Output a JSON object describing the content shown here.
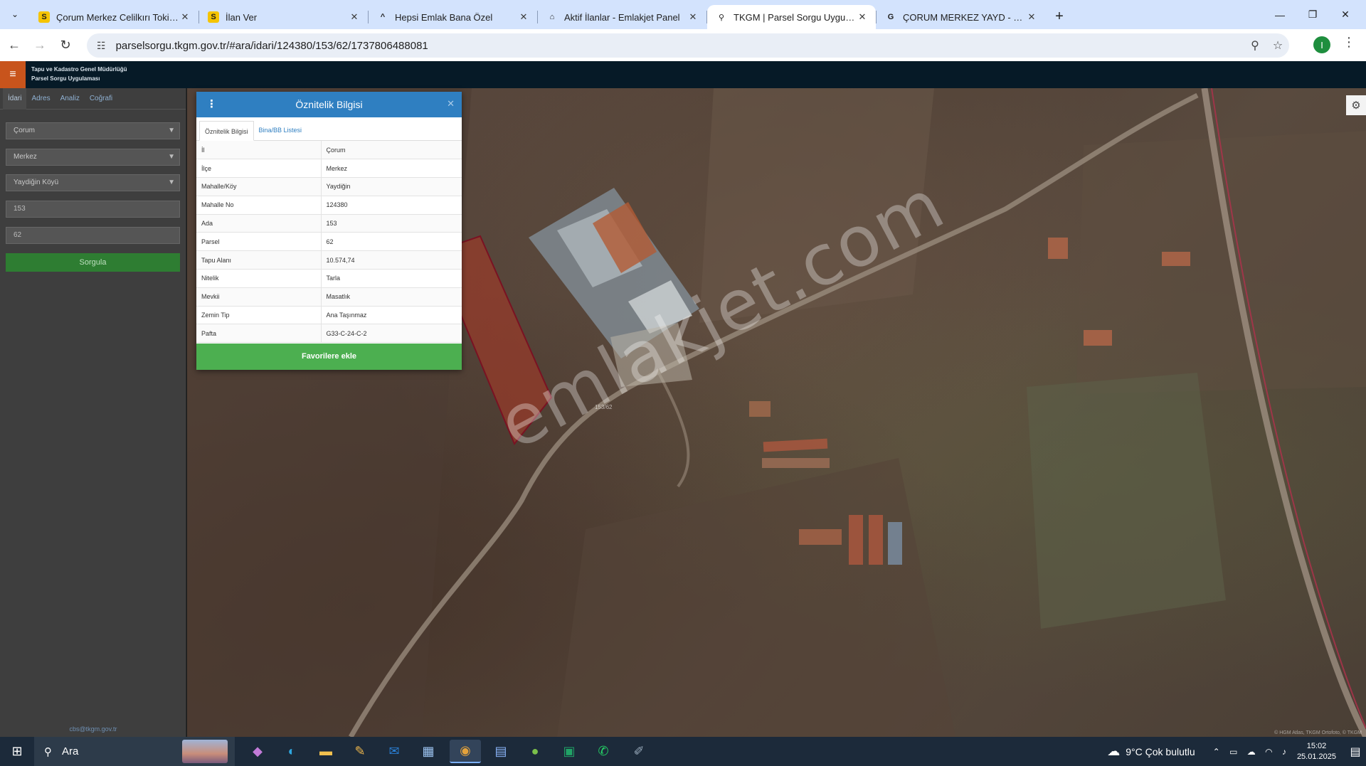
{
  "browser": {
    "tabs": [
      {
        "title": "Çorum Merkez Celilkırı Toki Anl",
        "favicon": "S",
        "favicon_bg": "#f5c400",
        "active": false
      },
      {
        "title": "İlan Ver",
        "favicon": "S",
        "favicon_bg": "#f5c400",
        "active": false
      },
      {
        "title": "Hepsi Emlak Bana Özel",
        "favicon": "^",
        "favicon_bg": "transparent",
        "active": false
      },
      {
        "title": "Aktif İlanlar - Emlakjet Panel",
        "favicon": "⌂",
        "favicon_bg": "transparent",
        "active": false
      },
      {
        "title": "TKGM | Parsel Sorgu Uygulaması",
        "favicon": "⚲",
        "favicon_bg": "transparent",
        "active": true
      },
      {
        "title": "ÇORUM MERKEZ YAYD - Google",
        "favicon": "G",
        "favicon_bg": "transparent",
        "active": false
      }
    ],
    "url": "parselsorgu.tkgm.gov.tr/#ara/idari/124380/153/62/1737806488081",
    "profile_initial": "I"
  },
  "app": {
    "title_line1": "Tapu ve Kadastro Genel Müdürlüğü",
    "title_line2": "Parsel Sorgu Uygulaması",
    "accent": "#c8541c"
  },
  "sidebar": {
    "tabs": [
      "İdari",
      "Adres",
      "Analiz",
      "Coğrafi"
    ],
    "province": "Çorum",
    "district": "Merkez",
    "neighborhood": "Yaydiğin Köyü",
    "ada": "153",
    "parsel": "62",
    "query_button": "Sorgula",
    "footer_email": "cbs@tkgm.gov.tr"
  },
  "panel": {
    "title": "Öznitelik Bilgisi",
    "tabs": [
      "Öznitelik Bilgisi",
      "Bina/BB Listesi"
    ],
    "rows": [
      {
        "key": "İl",
        "value": "Çorum"
      },
      {
        "key": "İlçe",
        "value": "Merkez"
      },
      {
        "key": "Mahalle/Köy",
        "value": "Yaydiğin"
      },
      {
        "key": "Mahalle No",
        "value": "124380"
      },
      {
        "key": "Ada",
        "value": "153"
      },
      {
        "key": "Parsel",
        "value": "62"
      },
      {
        "key": "Tapu Alanı",
        "value": "10.574,74"
      },
      {
        "key": "Nitelik",
        "value": "Tarla"
      },
      {
        "key": "Mevkii",
        "value": "Masatlık"
      },
      {
        "key": "Zemin Tip",
        "value": "Ana Taşınmaz"
      },
      {
        "key": "Pafta",
        "value": "G33-C-24-C-2"
      }
    ],
    "favorite_button": "Favorilere ekle",
    "header_color": "#2f7fc1",
    "button_color": "#4caf50"
  },
  "map": {
    "watermark": "emlakjet.com",
    "parcel_label": "153/62",
    "attribution": "© HGM Atlas, TKGM Ortofoto, © TKGM"
  },
  "taskbar": {
    "search_placeholder": "Ara",
    "weather": "9°C  Çok bulutlu",
    "time": "15:02",
    "date": "25.01.2025"
  }
}
